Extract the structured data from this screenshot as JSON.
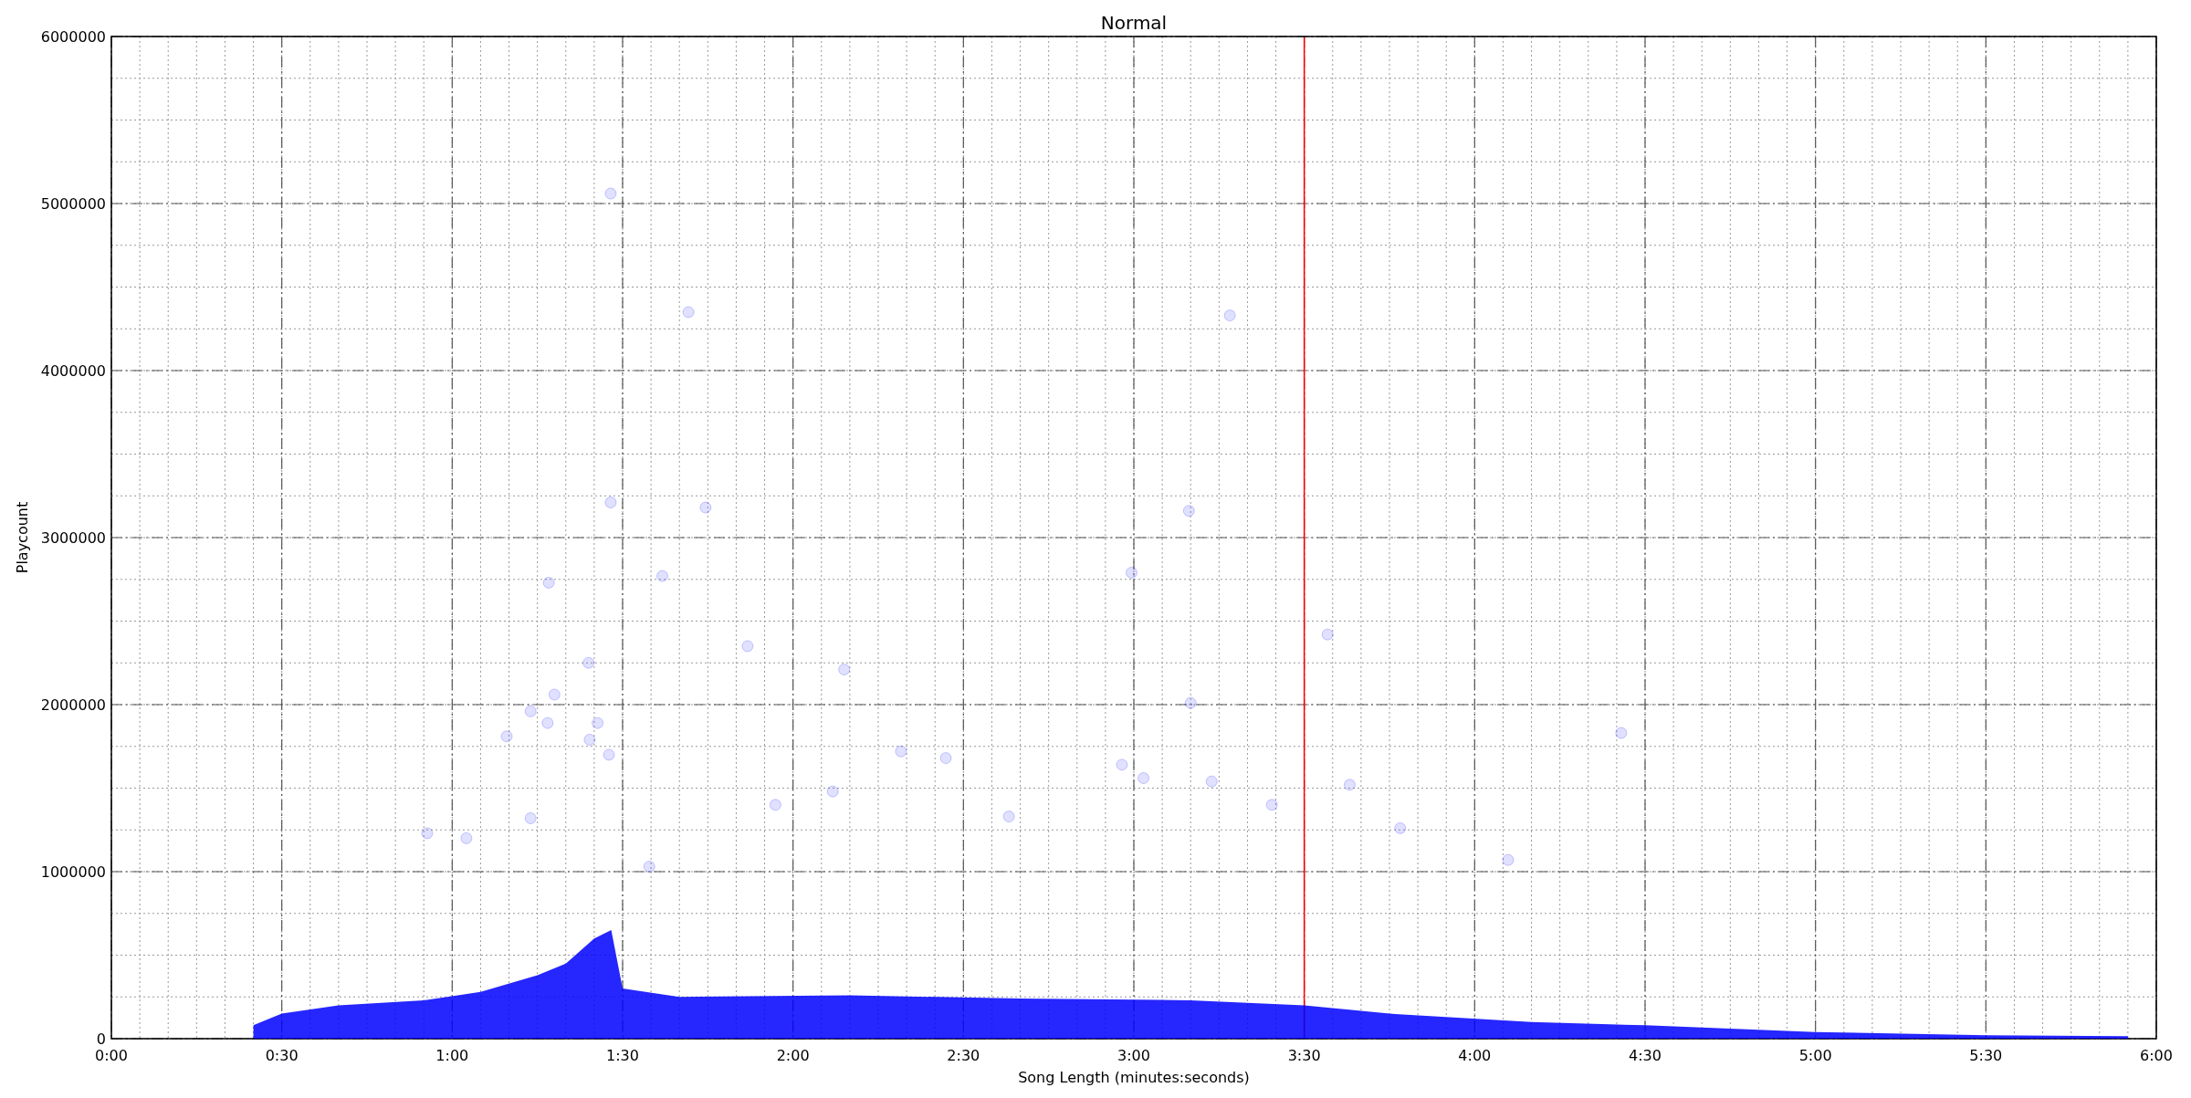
{
  "chart_data": {
    "type": "scatter",
    "title": "Normal",
    "xlabel": "Song Length (minutes:seconds)",
    "ylabel": "Playcount",
    "xlim": [
      0,
      360
    ],
    "ylim": [
      0,
      6000000
    ],
    "xticks": [
      {
        "value": 0,
        "label": "0:00"
      },
      {
        "value": 30,
        "label": "0:30"
      },
      {
        "value": 60,
        "label": "1:00"
      },
      {
        "value": 90,
        "label": "1:30"
      },
      {
        "value": 120,
        "label": "2:00"
      },
      {
        "value": 150,
        "label": "2:30"
      },
      {
        "value": 180,
        "label": "3:00"
      },
      {
        "value": 210,
        "label": "3:30"
      },
      {
        "value": 240,
        "label": "4:00"
      },
      {
        "value": 270,
        "label": "4:30"
      },
      {
        "value": 300,
        "label": "5:00"
      },
      {
        "value": 330,
        "label": "5:30"
      },
      {
        "value": 360,
        "label": "6:00"
      }
    ],
    "yticks": [
      0,
      1000000,
      2000000,
      3000000,
      4000000,
      5000000,
      6000000
    ],
    "grid": true,
    "series": [
      {
        "color": "#0000ff",
        "x": [
          87.9,
          101.6,
          196.9,
          87.9,
          104.6,
          189.7,
          97,
          179.6,
          77,
          214.1,
          112,
          84,
          129,
          78,
          190,
          73.8,
          76.8,
          85.6,
          265.8,
          69.6,
          84.2,
          87.6,
          139,
          146.9,
          177.9,
          181.7,
          193.7,
          218,
          127,
          116.9,
          204.3,
          73.8,
          158,
          226.9,
          55.6,
          62.5,
          245.9,
          94.7
        ],
        "values": [
          5060000,
          4350000,
          4330000,
          3210000,
          3180000,
          3160000,
          2770000,
          2790000,
          2730000,
          2420000,
          2350000,
          2250000,
          2210000,
          2060000,
          2010000,
          1960000,
          1890000,
          1890000,
          1830000,
          1810000,
          1790000,
          1700000,
          1720000,
          1680000,
          1640000,
          1560000,
          1540000,
          1520000,
          1480000,
          1400000,
          1400000,
          1320000,
          1330000,
          1260000,
          1230000,
          1200000,
          1070000,
          1030000
        ]
      }
    ],
    "ref_lines": [
      {
        "axis": "x",
        "value": 210,
        "color": "#ff0000"
      }
    ]
  }
}
